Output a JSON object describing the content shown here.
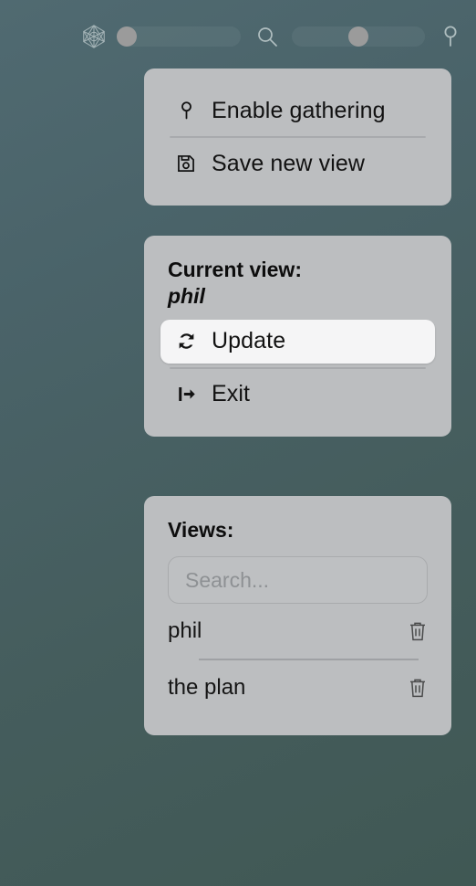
{
  "toolbar": {
    "logo_icon": "hexagon-logo-icon",
    "left_slider": {
      "name": "left-slider",
      "handle_position": "start"
    },
    "search_icon": "search-icon",
    "right_slider": {
      "name": "right-slider",
      "handle_position": "middle"
    },
    "pin_icon": "pin-icon"
  },
  "actions_panel": {
    "items": [
      {
        "label": "Enable gathering",
        "icon": "pin-icon"
      },
      {
        "label": "Save new view",
        "icon": "floppy-disk-icon"
      }
    ]
  },
  "current_view_panel": {
    "heading": "Current view:",
    "name": "phil",
    "items": [
      {
        "label": "Update",
        "icon": "refresh-icon",
        "highlighted": true
      },
      {
        "label": "Exit",
        "icon": "exit-icon",
        "highlighted": false
      }
    ]
  },
  "views_panel": {
    "heading": "Views:",
    "search": {
      "value": "",
      "placeholder": "Search..."
    },
    "items": [
      {
        "name": "phil",
        "delete_icon": "trash-icon"
      },
      {
        "name": "the plan",
        "delete_icon": "trash-icon"
      }
    ]
  },
  "colors": {
    "background_top": "#506a71",
    "background_bottom": "#405854",
    "panel": "#bcbec0",
    "highlight_row": "#f5f5f6",
    "text": "#121212",
    "slider_handle": "#9b9b9b"
  }
}
